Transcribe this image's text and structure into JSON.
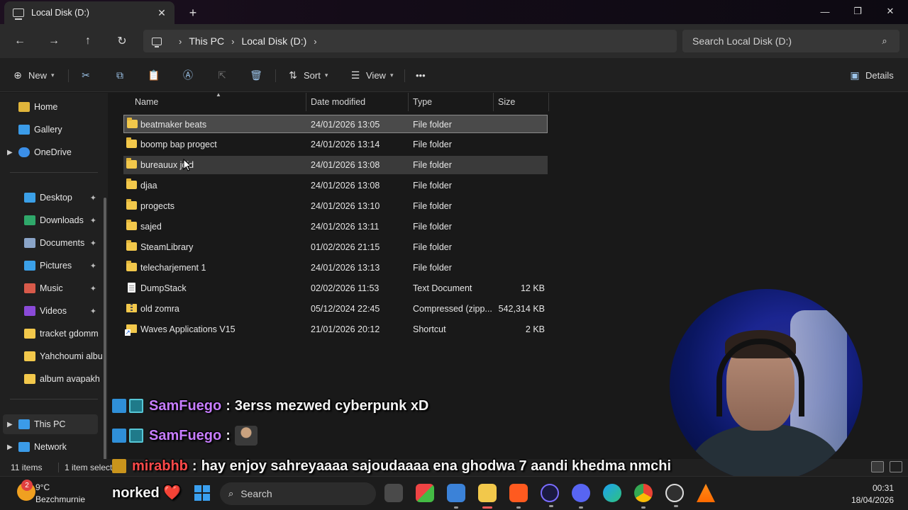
{
  "window": {
    "tab_title": "Local Disk (D:)"
  },
  "address": {
    "crumbs": [
      "This PC",
      "Local Disk (D:)"
    ],
    "search_placeholder": "Search Local Disk (D:)"
  },
  "toolbar": {
    "new_label": "New",
    "sort_label": "Sort",
    "view_label": "View",
    "more_label": "•••",
    "details_label": "Details"
  },
  "sidebar": {
    "items": [
      {
        "label": "Home",
        "icon": "home-icon",
        "color": "#e0b53b"
      },
      {
        "label": "Gallery",
        "icon": "gallery-icon",
        "color": "#3b9be8"
      },
      {
        "label": "OneDrive",
        "icon": "cloud-icon",
        "color": "#3b8fe8"
      },
      {
        "label": "Desktop",
        "icon": "desktop-icon",
        "color": "#3ba0e8",
        "pinned": true
      },
      {
        "label": "Downloads",
        "icon": "download-icon",
        "color": "#2fa86a",
        "pinned": true
      },
      {
        "label": "Documents",
        "icon": "documents-icon",
        "color": "#8aa4c8",
        "pinned": true
      },
      {
        "label": "Pictures",
        "icon": "pictures-icon",
        "color": "#3ba0e8",
        "pinned": true
      },
      {
        "label": "Music",
        "icon": "music-icon",
        "color": "#d85a4a",
        "pinned": true
      },
      {
        "label": "Videos",
        "icon": "videos-icon",
        "color": "#8a4ad8",
        "pinned": true
      },
      {
        "label": "tracket gdomm",
        "icon": "folder-icon",
        "color": "#f2c84b"
      },
      {
        "label": "Yahchoumi albu",
        "icon": "folder-icon",
        "color": "#f2c84b"
      },
      {
        "label": "album avapakh",
        "icon": "folder-icon",
        "color": "#f2c84b"
      },
      {
        "label": "This PC",
        "icon": "pc-icon",
        "color": "#3b9be8"
      },
      {
        "label": "Network",
        "icon": "network-icon",
        "color": "#3b9be8"
      }
    ],
    "pin_glyph": "📌"
  },
  "columns": {
    "name": "Name",
    "date": "Date modified",
    "type": "Type",
    "size": "Size"
  },
  "files": [
    {
      "name": "beatmaker beats",
      "date": "24/01/2026 13:05",
      "type": "File folder",
      "size": "",
      "kind": "folder"
    },
    {
      "name": "boomp bap progect",
      "date": "24/01/2026 13:14",
      "type": "File folder",
      "size": "",
      "kind": "folder"
    },
    {
      "name": "bureauux jdid",
      "date": "24/01/2026 13:08",
      "type": "File folder",
      "size": "",
      "kind": "folder"
    },
    {
      "name": "djaa",
      "date": "24/01/2026 13:08",
      "type": "File folder",
      "size": "",
      "kind": "folder"
    },
    {
      "name": "progects",
      "date": "24/01/2026 13:10",
      "type": "File folder",
      "size": "",
      "kind": "folder"
    },
    {
      "name": "sajed",
      "date": "24/01/2026 13:11",
      "type": "File folder",
      "size": "",
      "kind": "folder"
    },
    {
      "name": "SteamLibrary",
      "date": "01/02/2026 21:15",
      "type": "File folder",
      "size": "",
      "kind": "folder"
    },
    {
      "name": "telecharjement 1",
      "date": "24/01/2026 13:13",
      "type": "File folder",
      "size": "",
      "kind": "folder"
    },
    {
      "name": "DumpStack",
      "date": "02/02/2026 11:53",
      "type": "Text Document",
      "size": "12 KB",
      "kind": "doc"
    },
    {
      "name": "old zomra",
      "date": "05/12/2024 22:45",
      "type": "Compressed (zipp...",
      "size": "542,314 KB",
      "kind": "zip"
    },
    {
      "name": "Waves Applications V15",
      "date": "21/01/2026 20:12",
      "type": "Shortcut",
      "size": "2 KB",
      "kind": "link"
    }
  ],
  "status": {
    "count": "11 items",
    "selected": "1 item selected"
  },
  "chat": [
    {
      "user": "SamFuego",
      "message": "3erss mezwed cyberpunk xD",
      "user_color": "#c77dff"
    },
    {
      "user": "SamFuego",
      "message": "",
      "emote": true,
      "user_color": "#c77dff"
    },
    {
      "user": "mirabhb",
      "message": "hay enjoy sahreyaaaa sajoudaaaa ena ghodwa 7 aandi khedma nmchi",
      "user_color": "#ff4a4a"
    },
    {
      "user": "",
      "message": "norked ❤️"
    }
  ],
  "taskbar": {
    "weather_temp": "9°C",
    "weather_place": "Bezchmurnie",
    "weather_badge": "2",
    "search_label": "Search",
    "time": "00:31",
    "date": "18/04/2026"
  }
}
